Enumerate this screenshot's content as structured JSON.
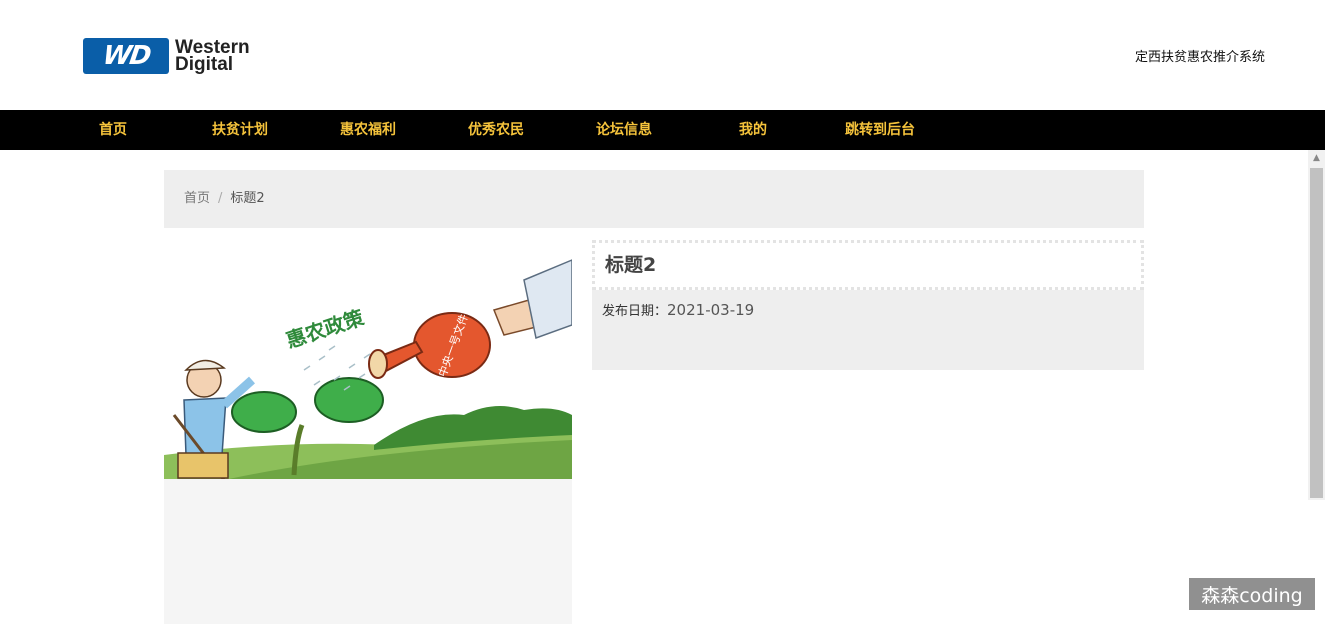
{
  "header": {
    "logo_line1": "Western",
    "logo_line2": "Digital",
    "logo_mark": "WD",
    "site_name": "定西扶贫惠农推介系统"
  },
  "nav": {
    "items": [
      {
        "label": "首页"
      },
      {
        "label": "扶贫计划"
      },
      {
        "label": "惠农福利"
      },
      {
        "label": "优秀农民"
      },
      {
        "label": "论坛信息"
      },
      {
        "label": "我的"
      },
      {
        "label": "跳转到后台"
      }
    ]
  },
  "breadcrumb": {
    "home": "首页",
    "separator": "/",
    "current": "标题2"
  },
  "article": {
    "title": "标题2",
    "date_label": "发布日期：",
    "date_value": "2021-03-19",
    "image_caption_slogan": "惠农政策",
    "image_can_text": "中央一号文件"
  },
  "watermark": "森森coding",
  "colors": {
    "nav_bg": "#000000",
    "nav_text": "#f5c33b",
    "logo_blue": "#0a5ea8",
    "panel_bg": "#eeeeee"
  }
}
